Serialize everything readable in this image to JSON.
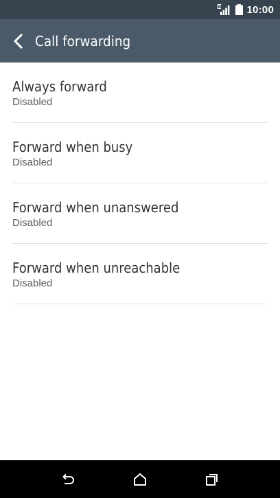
{
  "status_bar": {
    "time": "10:00",
    "icons": [
      "signal-icon",
      "battery-icon"
    ]
  },
  "app_bar": {
    "back_icon": "chevron-left-icon",
    "title": "Call forwarding"
  },
  "settings": {
    "items": [
      {
        "title": "Always forward",
        "subtitle": "Disabled"
      },
      {
        "title": "Forward when busy",
        "subtitle": "Disabled"
      },
      {
        "title": "Forward when unanswered",
        "subtitle": "Disabled"
      },
      {
        "title": "Forward when unreachable",
        "subtitle": "Disabled"
      }
    ]
  },
  "nav_bar": {
    "buttons": [
      "back-arrow-icon",
      "home-icon",
      "recents-icon"
    ]
  },
  "colors": {
    "status_bar": "#37434f",
    "app_bar": "#4a5a69",
    "divider": "#e2e2e2",
    "nav_bar": "#000000"
  }
}
